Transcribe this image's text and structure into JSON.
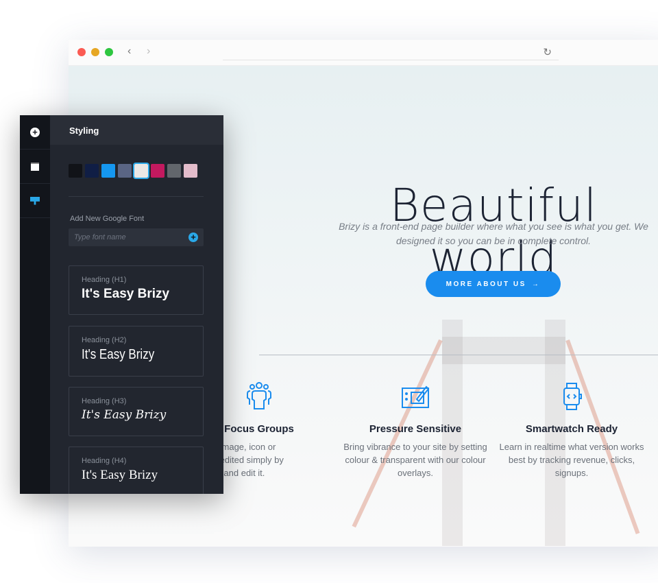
{
  "browser": {
    "back": "‹",
    "forward": "›",
    "reload": "↻",
    "dots": [
      "#fb5b53",
      "#e6a724",
      "#2ec640"
    ]
  },
  "hero": {
    "title": "Beautiful world",
    "description": "Brizy is a front-end page builder where what you see is what you get. We designed it so you can be in complete control.",
    "button_label": "MORE ABOUT US"
  },
  "features": [
    {
      "icon": "users-icon",
      "title": "Focus Groups",
      "text": "ry text, image, icon or\n can be edited simply by\nelecting and edit it."
    },
    {
      "icon": "drawing-tablet-icon",
      "title": "Pressure Sensitive",
      "text": "Bring vibrance to your site by setting colour & transparent with our colour overlays."
    },
    {
      "icon": "smartwatch-icon",
      "title": "Smartwatch Ready",
      "text": "Learn in realtime what version works best by tracking revenue, clicks, signups."
    }
  ],
  "panel": {
    "title": "Styling",
    "swatches": [
      "#111318",
      "#101e45",
      "#1597f0",
      "#5a6584",
      "#ebe8e5",
      "#c3195f",
      "#62666c",
      "#e3bccb"
    ],
    "selected_swatch": 4,
    "font_label": "Add New Google Font",
    "font_placeholder": "Type font name",
    "headings": [
      {
        "label": "Heading (H1)",
        "sample": "It's Easy Brizy"
      },
      {
        "label": "Heading (H2)",
        "sample": "It's Easy Brizy"
      },
      {
        "label": "Heading (H3)",
        "sample": "It's Easy Brizy"
      },
      {
        "label": "Heading (H4)",
        "sample": "It's Easy Brizy"
      }
    ]
  }
}
